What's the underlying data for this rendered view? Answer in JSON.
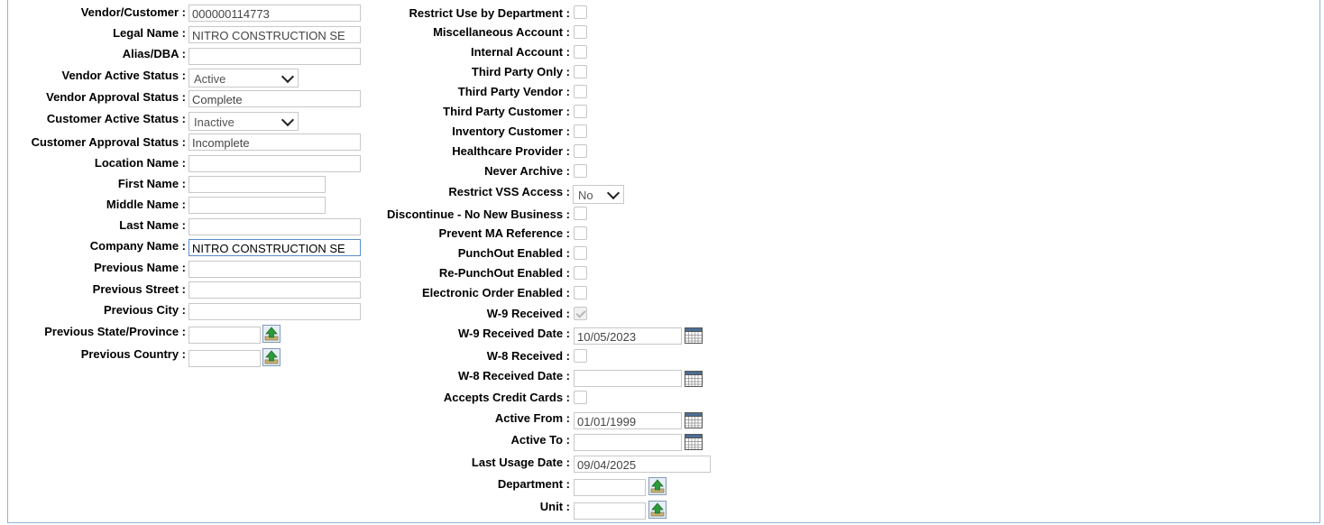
{
  "left": {
    "vendor_customer": {
      "label": "Vendor/Customer :",
      "value": "000000114773"
    },
    "legal_name": {
      "label": "Legal Name :",
      "value": "NITRO CONSTRUCTION SE"
    },
    "alias_dba": {
      "label": "Alias/DBA :",
      "value": ""
    },
    "vendor_active_status": {
      "label": "Vendor Active Status :",
      "value": "Active"
    },
    "vendor_approval_status": {
      "label": "Vendor Approval Status :",
      "value": "Complete"
    },
    "customer_active_status": {
      "label": "Customer Active Status :",
      "value": "Inactive"
    },
    "customer_approval_status": {
      "label": "Customer Approval Status :",
      "value": "Incomplete"
    },
    "location_name": {
      "label": "Location Name :",
      "value": ""
    },
    "first_name": {
      "label": "First Name :",
      "value": ""
    },
    "middle_name": {
      "label": "Middle Name :",
      "value": ""
    },
    "last_name": {
      "label": "Last Name :",
      "value": ""
    },
    "company_name": {
      "label": "Company Name :",
      "value": "NITRO CONSTRUCTION SE"
    },
    "previous_name": {
      "label": "Previous Name :",
      "value": ""
    },
    "previous_street": {
      "label": "Previous Street :",
      "value": ""
    },
    "previous_city": {
      "label": "Previous City :",
      "value": ""
    },
    "previous_state": {
      "label": "Previous State/Province :",
      "value": ""
    },
    "previous_country": {
      "label": "Previous Country :",
      "value": ""
    }
  },
  "right": {
    "restrict_use_by_department": {
      "label": "Restrict Use by Department :",
      "checked": false
    },
    "miscellaneous_account": {
      "label": "Miscellaneous Account :",
      "checked": false
    },
    "internal_account": {
      "label": "Internal Account :",
      "checked": false
    },
    "third_party_only": {
      "label": "Third Party Only :",
      "checked": false
    },
    "third_party_vendor": {
      "label": "Third Party Vendor :",
      "checked": false
    },
    "third_party_customer": {
      "label": "Third Party Customer :",
      "checked": false
    },
    "inventory_customer": {
      "label": "Inventory Customer :",
      "checked": false
    },
    "healthcare_provider": {
      "label": "Healthcare Provider :",
      "checked": false
    },
    "never_archive": {
      "label": "Never Archive :",
      "checked": false
    },
    "restrict_vss_access": {
      "label": "Restrict VSS Access :",
      "value": "No"
    },
    "discontinue_no_new_business": {
      "label": "Discontinue - No New Business :",
      "checked": false
    },
    "prevent_ma_reference": {
      "label": "Prevent MA Reference :",
      "checked": false
    },
    "punchout_enabled": {
      "label": "PunchOut Enabled :",
      "checked": false
    },
    "re_punchout_enabled": {
      "label": "Re-PunchOut Enabled :",
      "checked": false
    },
    "electronic_order_enabled": {
      "label": "Electronic Order Enabled :",
      "checked": false
    },
    "w9_received": {
      "label": "W-9 Received :",
      "checked": true
    },
    "w9_received_date": {
      "label": "W-9 Received Date :",
      "value": "10/05/2023"
    },
    "w8_received": {
      "label": "W-8 Received :",
      "checked": false
    },
    "w8_received_date": {
      "label": "W-8 Received Date :",
      "value": ""
    },
    "accepts_credit_cards": {
      "label": "Accepts Credit Cards :",
      "checked": false
    },
    "active_from": {
      "label": "Active From :",
      "value": "01/01/1999"
    },
    "active_to": {
      "label": "Active To :",
      "value": ""
    },
    "last_usage_date": {
      "label": "Last Usage Date :",
      "value": "09/04/2025"
    },
    "department": {
      "label": "Department :",
      "value": ""
    },
    "unit": {
      "label": "Unit :",
      "value": ""
    }
  },
  "icons": {
    "lookup": "lookup-arrow-icon",
    "calendar": "calendar-icon"
  },
  "colors": {
    "frame": "#8cb4d6",
    "focus_border": "#5b8ec4",
    "lookup_green": "#2e9a3a"
  }
}
